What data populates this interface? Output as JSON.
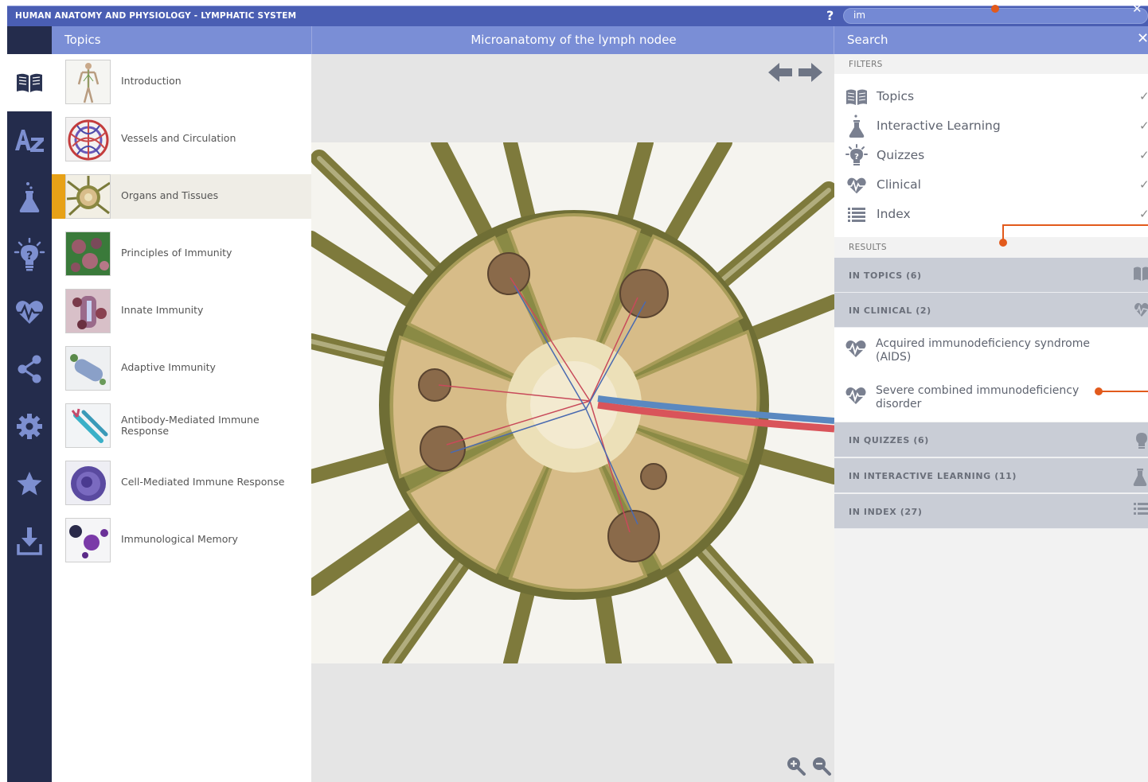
{
  "app": {
    "title": "HUMAN ANATOMY AND PHYSIOLOGY - LYMPHATIC SYSTEM",
    "help": "?",
    "search_value": "im",
    "search_clear": "✕"
  },
  "nav": {
    "items": [
      {
        "icon": "book-icon",
        "active": true
      },
      {
        "icon": "az-index-icon",
        "active": false
      },
      {
        "icon": "flask-icon",
        "active": false
      },
      {
        "icon": "lightbulb-quiz-icon",
        "active": false
      },
      {
        "icon": "heart-pulse-icon",
        "active": false
      },
      {
        "icon": "share-icon",
        "active": false
      },
      {
        "icon": "gear-icon",
        "active": false
      },
      {
        "icon": "star-icon",
        "active": false
      },
      {
        "icon": "download-icon",
        "active": false
      }
    ]
  },
  "topics": {
    "title": "Topics",
    "items": [
      {
        "label": "Introduction",
        "selected": false
      },
      {
        "label": "Vessels and Circulation",
        "selected": false
      },
      {
        "label": "Organs and Tissues",
        "selected": true
      },
      {
        "label": "Principles of Immunity",
        "selected": false
      },
      {
        "label": "Innate Immunity",
        "selected": false
      },
      {
        "label": "Adaptive Immunity",
        "selected": false
      },
      {
        "label": "Antibody-Mediated Immune Response",
        "selected": false
      },
      {
        "label": "Cell-Mediated Immune Response",
        "selected": false
      },
      {
        "label": "Immunological Memory",
        "selected": false
      }
    ]
  },
  "viewer": {
    "title": "Microanatomy of the lymph nodee",
    "colors": {
      "background": "#e5e5e5",
      "tissue": "#7a7a3a",
      "lobule": "#d8bd8a"
    }
  },
  "search": {
    "title": "Search",
    "close": "✕",
    "filters_label": "FILTERS",
    "filters": [
      {
        "label": "Topics",
        "icon": "book-icon",
        "checked": true
      },
      {
        "label": "Interactive Learning",
        "icon": "flask-icon",
        "checked": true
      },
      {
        "label": "Quizzes",
        "icon": "lightbulb-quiz-icon",
        "checked": true
      },
      {
        "label": "Clinical",
        "icon": "heart-pulse-icon",
        "checked": true
      },
      {
        "label": "Index",
        "icon": "list-icon",
        "checked": true
      }
    ],
    "check_mark": "✓",
    "results_label": "RESULTS",
    "groups": {
      "topics": "IN TOPICS (6)",
      "clinical": "IN CLINICAL (2)",
      "quizzes": "IN QUIZZES (6)",
      "interactive": "IN INTERACTIVE LEARNING (11)",
      "index": "IN INDEX (27)"
    },
    "clinical_results": [
      {
        "label": "Acquired immunodeficiency syndrome (AIDS)"
      },
      {
        "label": "Severe combined immunodeficiency disorder"
      }
    ]
  },
  "colors": {
    "accent": "#7a8ed6",
    "titlebar": "#4a5eb3",
    "nav": "#242c4c",
    "selection": "#e7a117",
    "callout": "#e25a1c"
  }
}
